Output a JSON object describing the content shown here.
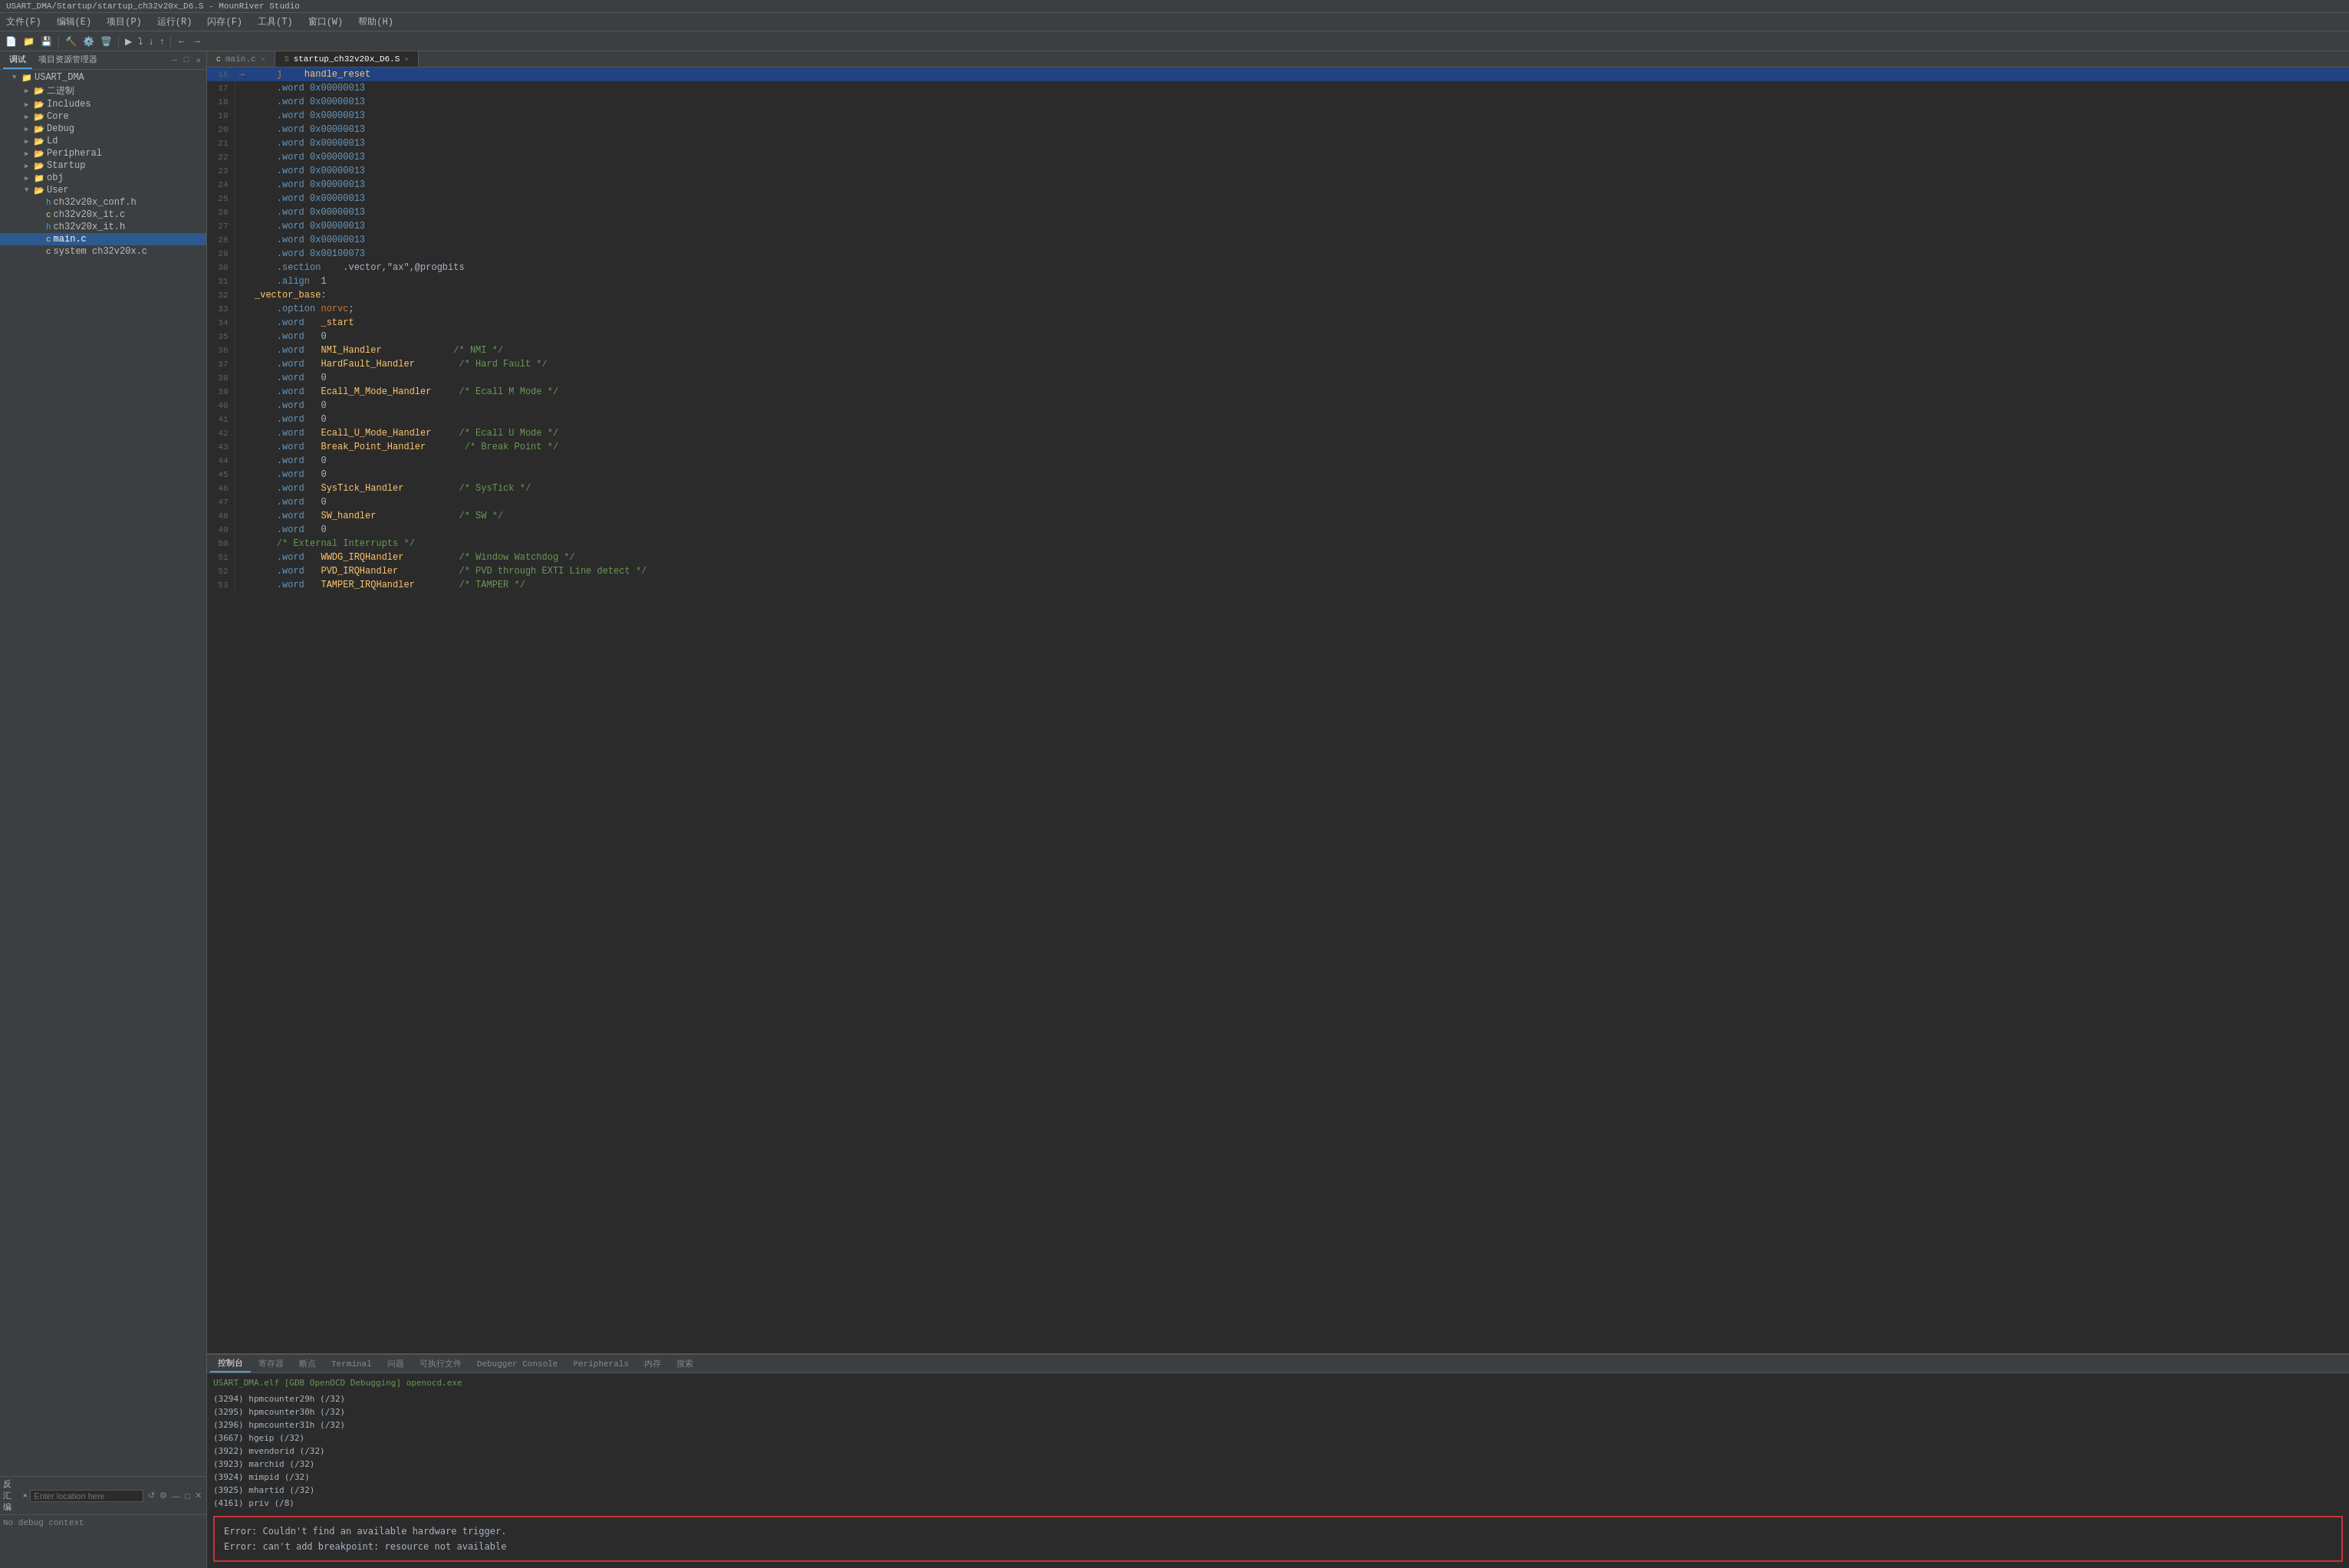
{
  "titleBar": {
    "text": "USART_DMA/Startup/startup_ch32v20x_D6.S - MounRiver Studio"
  },
  "menuBar": {
    "items": [
      {
        "label": "文件(F)"
      },
      {
        "label": "编辑(E)"
      },
      {
        "label": "项目(P)"
      },
      {
        "label": "运行(R)"
      },
      {
        "label": "闪存(F)"
      },
      {
        "label": "工具(T)"
      },
      {
        "label": "窗口(W)"
      },
      {
        "label": "帮助(H)"
      }
    ]
  },
  "leftPanel": {
    "tabs": [
      {
        "label": "调试",
        "active": true
      },
      {
        "label": "项目资源管理器",
        "active": false
      }
    ],
    "tree": {
      "root": "USART_DMA",
      "items": [
        {
          "label": "USART_DMA",
          "indent": 0,
          "expanded": true,
          "type": "root"
        },
        {
          "label": "二进制",
          "indent": 1,
          "expanded": false,
          "type": "folder"
        },
        {
          "label": "Includes",
          "indent": 1,
          "expanded": false,
          "type": "folder"
        },
        {
          "label": "Core",
          "indent": 1,
          "expanded": false,
          "type": "folder"
        },
        {
          "label": "Debug",
          "indent": 1,
          "expanded": false,
          "type": "folder"
        },
        {
          "label": "Ld",
          "indent": 1,
          "expanded": false,
          "type": "folder"
        },
        {
          "label": "Peripheral",
          "indent": 1,
          "expanded": false,
          "type": "folder"
        },
        {
          "label": "Startup",
          "indent": 1,
          "expanded": false,
          "type": "folder"
        },
        {
          "label": "obj",
          "indent": 1,
          "expanded": false,
          "type": "folder"
        },
        {
          "label": "User",
          "indent": 1,
          "expanded": true,
          "type": "folder"
        },
        {
          "label": "ch32v20x_conf.h",
          "indent": 2,
          "type": "file-h"
        },
        {
          "label": "ch32v20x_it.c",
          "indent": 2,
          "type": "file-c"
        },
        {
          "label": "ch32v20x_it.h",
          "indent": 2,
          "type": "file-h"
        },
        {
          "label": "main.c",
          "indent": 2,
          "type": "file-c",
          "selected": true
        },
        {
          "label": "system ch32v20x.c",
          "indent": 2,
          "type": "file-c"
        }
      ]
    }
  },
  "disasmPanel": {
    "label": "反汇编",
    "inputPlaceholder": "Enter location here",
    "noDebugText": "No debug context"
  },
  "editorTabs": [
    {
      "label": "main.c",
      "active": false,
      "icon": "c-file"
    },
    {
      "label": "startup_ch32v20x_D6.S",
      "active": true,
      "icon": "asm-file"
    }
  ],
  "codeLines": [
    {
      "num": 16,
      "arrow": true,
      "content": "    j    handle_reset",
      "highlight": true
    },
    {
      "num": 17,
      "content": "    .word 0x00000013"
    },
    {
      "num": 18,
      "content": "    .word 0x00000013"
    },
    {
      "num": 19,
      "content": "    .word 0x00000013"
    },
    {
      "num": 20,
      "content": "    .word 0x00000013"
    },
    {
      "num": 21,
      "content": "    .word 0x00000013"
    },
    {
      "num": 22,
      "content": "    .word 0x00000013"
    },
    {
      "num": 23,
      "content": "    .word 0x00000013"
    },
    {
      "num": 24,
      "content": "    .word 0x00000013"
    },
    {
      "num": 25,
      "content": "    .word 0x00000013"
    },
    {
      "num": 26,
      "content": "    .word 0x00000013"
    },
    {
      "num": 27,
      "content": "    .word 0x00000013"
    },
    {
      "num": 28,
      "content": "    .word 0x00000013"
    },
    {
      "num": 29,
      "content": "    .word 0x00100073"
    },
    {
      "num": 30,
      "content": "    .section    .vector,\"ax\",@progbits"
    },
    {
      "num": 31,
      "content": "    .align  1"
    },
    {
      "num": 32,
      "content": "_vector_base:"
    },
    {
      "num": 33,
      "content": "    .option norvc;"
    },
    {
      "num": 34,
      "content": "    .word   _start"
    },
    {
      "num": 35,
      "content": "    .word   0"
    },
    {
      "num": 36,
      "content": "    .word   NMI_Handler             /* NMI */"
    },
    {
      "num": 37,
      "content": "    .word   HardFault_Handler        /* Hard Fault */"
    },
    {
      "num": 38,
      "content": "    .word   0"
    },
    {
      "num": 39,
      "content": "    .word   Ecall_M_Mode_Handler     /* Ecall M Mode */"
    },
    {
      "num": 40,
      "content": "    .word   0"
    },
    {
      "num": 41,
      "content": "    .word   0"
    },
    {
      "num": 42,
      "content": "    .word   Ecall_U_Mode_Handler     /* Ecall U Mode */"
    },
    {
      "num": 43,
      "content": "    .word   Break_Point_Handler       /* Break Point */"
    },
    {
      "num": 44,
      "content": "    .word   0"
    },
    {
      "num": 45,
      "content": "    .word   0"
    },
    {
      "num": 46,
      "content": "    .word   SysTick_Handler          /* SysTick */"
    },
    {
      "num": 47,
      "content": "    .word   0"
    },
    {
      "num": 48,
      "content": "    .word   SW_handler               /* SW */"
    },
    {
      "num": 49,
      "content": "    .word   0"
    },
    {
      "num": 50,
      "content": "    /* External Interrupts */"
    },
    {
      "num": 51,
      "content": "    .word   WWDG_IRQHandler          /* Window Watchdog */"
    },
    {
      "num": 52,
      "content": "    .word   PVD_IRQHandler           /* PVD through EXTI Line detect */"
    },
    {
      "num": 53,
      "content": "    .word   TAMPER_IRQHandler        /* TAMPER */"
    }
  ],
  "bottomPanel": {
    "tabs": [
      {
        "label": "控制台",
        "active": true
      },
      {
        "label": "寄存器"
      },
      {
        "label": "断点"
      },
      {
        "label": "Terminal"
      },
      {
        "label": "问题"
      },
      {
        "label": "可执行文件"
      },
      {
        "label": "Debugger Console"
      },
      {
        "label": "Peripherals"
      },
      {
        "label": "内存"
      },
      {
        "label": "搜索"
      }
    ],
    "consoleTitle": "USART_DMA.elf [GDB OpenOCD Debugging] openocd.exe",
    "consoleLines": [
      "(3294) hpmcounter29h (/32)",
      "(3295) hpmcounter30h (/32)",
      "(3296) hpmcounter31h (/32)",
      "(3667) hgeip (/32)",
      "(3922) mvendorid (/32)",
      "(3923) marchid (/32)",
      "(3924) mimpid (/32)",
      "(3925) mhartid (/32)",
      "(4161) priv (/8)"
    ],
    "errorBox": {
      "line1": "Error: Couldn't find an available hardware trigger.",
      "line2": "Error: can't add breakpoint: resource not available"
    }
  }
}
